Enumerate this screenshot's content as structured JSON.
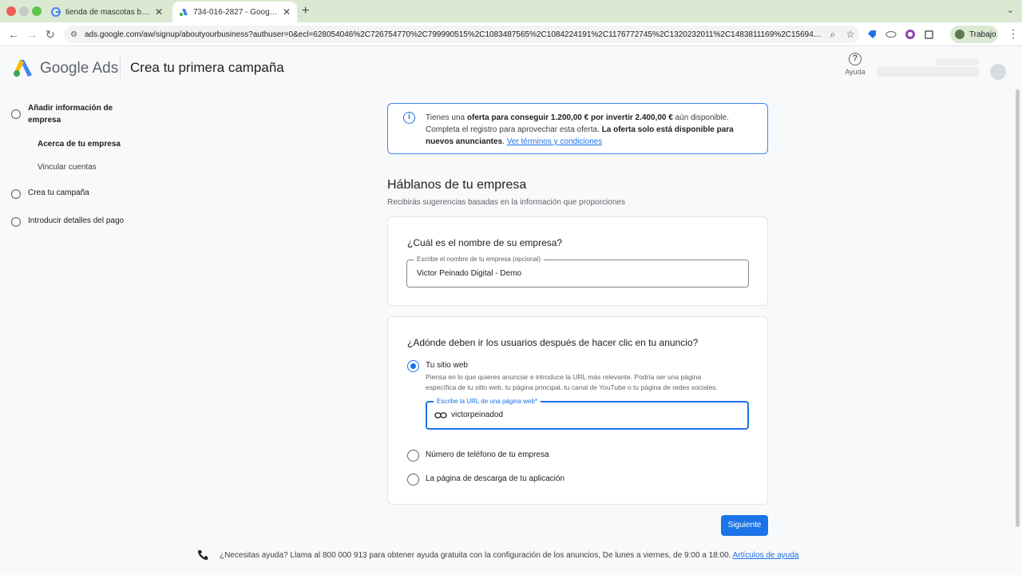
{
  "browser": {
    "tabs": [
      {
        "title": "tienda de mascotas barcelona",
        "close": "✕"
      },
      {
        "title": "734-016-2827 - Google Ads",
        "close": "✕"
      }
    ],
    "new_tab": "+",
    "url": "ads.google.com/aw/signup/aboutyourbusiness?authuser=0&ecl=628054046%2C726754770%2C799990515%2C1083487565%2C1084224191%2C1176772745%2C1320232011%2C1483811169%2C156943...",
    "profile_label": "Trabajo"
  },
  "header": {
    "brand": "Google Ads",
    "title": "Crea tu primera campaña",
    "help_label": "Ayuda"
  },
  "stepper": {
    "steps": [
      {
        "label_line1": "Añadir información de",
        "label_line2": "empresa"
      },
      {
        "label": "Crea tu campaña"
      },
      {
        "label": "Introducir detalles del pago"
      }
    ],
    "substeps": [
      "Acerca de tu empresa",
      "Vincular cuentas"
    ]
  },
  "offer": {
    "t1": "Tienes una ",
    "b1": "oferta para conseguir 1.200,00 € por invertir 2.400,00 €",
    "t2": " aún disponible.",
    "t3": "Completa el registro para aprovechar esta oferta. ",
    "b2": "La oferta solo está disponible para",
    "b3": "nuevos anunciantes",
    "t4": ". ",
    "link": "Ver términos y condiciones"
  },
  "section": {
    "title": "Háblanos de tu empresa",
    "subtitle": "Recibirás sugerencias basadas en la información que proporciones"
  },
  "business_card": {
    "question": "¿Cuál es el nombre de su empresa?",
    "field_label": "Escribe el nombre de tu empresa (opcional)",
    "field_value": "Victor Peinado Digital - Demo"
  },
  "destination_card": {
    "question": "¿Adónde deben ir los usuarios después de hacer clic en tu anuncio?",
    "options": [
      {
        "label": "Tu sitio web",
        "selected": true
      },
      {
        "label": "Número de teléfono de tu empresa",
        "selected": false
      },
      {
        "label": "La página de descarga de tu aplicación",
        "selected": false
      }
    ],
    "help_line1": "Piensa en lo que quieres anunciar e introduce la URL más relevante. Podría ser una página",
    "help_line2": "específica de tu sitio web, tu página principal, tu canal de YouTube o tu página de redes sociales.",
    "url_label": "Escribe la URL de una página web*",
    "url_value": "victorpeinadod"
  },
  "actions": {
    "next": "Siguiente"
  },
  "footer": {
    "text": "¿Necesitas ayuda? Llama al 800 000 913 para obtener ayuda gratuita con la configuración de los anuncios, De lunes a viernes, de 9:00 a 18:00. ",
    "link": "Artículos de ayuda"
  },
  "colors": {
    "accent": "#1a73e8",
    "tabbar": "#dbe9d3"
  }
}
